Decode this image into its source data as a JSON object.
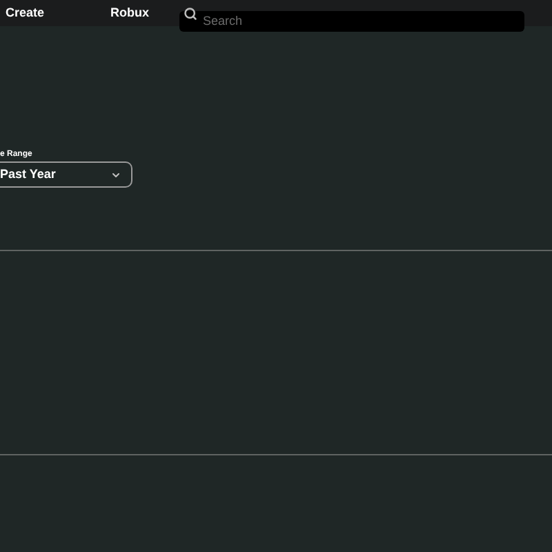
{
  "nav": {
    "items": [
      "Create",
      "Robux"
    ]
  },
  "search": {
    "placeholder": "Search"
  },
  "filter": {
    "label": "e Range",
    "value": "Past Year"
  }
}
